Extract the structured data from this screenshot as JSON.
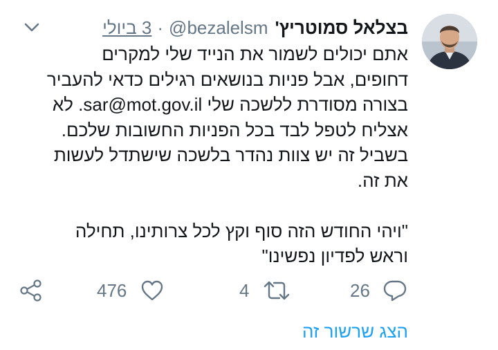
{
  "tweet": {
    "author_name": "בצלאל סמוטריץ'",
    "author_handle": "@bezalelsm",
    "separator": "·",
    "date": "3 ביולי",
    "body_lines": [
      "אתם יכולים לשמור את הנייד שלי למקרים",
      "דחופים, אבל פניות בנושאים רגילים כדאי להעביר",
      "בצורה מסודרת ללשכה שלי sar@mot.gov.il. לא",
      "אצליח לטפל לבד בכל הפניות החשובות שלכם.",
      "בשביל זה יש צוות נהדר בלשכה שישתדל לעשות",
      "את זה."
    ],
    "quote_lines": [
      "\"ויהי החודש הזה סוף וקץ לכל צרותינו, תחילה",
      "וראש לפדיון נפשינו\""
    ]
  },
  "actions": {
    "reply_count": "26",
    "retweet_count": "4",
    "like_count": "476"
  },
  "show_thread_label": "הצג שרשור זה",
  "icons": {
    "reply": "reply-icon",
    "retweet": "retweet-icon",
    "like": "heart-icon",
    "share": "share-icon",
    "menu": "chevron-down-icon"
  },
  "colors": {
    "text": "#14171a",
    "muted": "#657786",
    "link": "#1da1f2"
  }
}
